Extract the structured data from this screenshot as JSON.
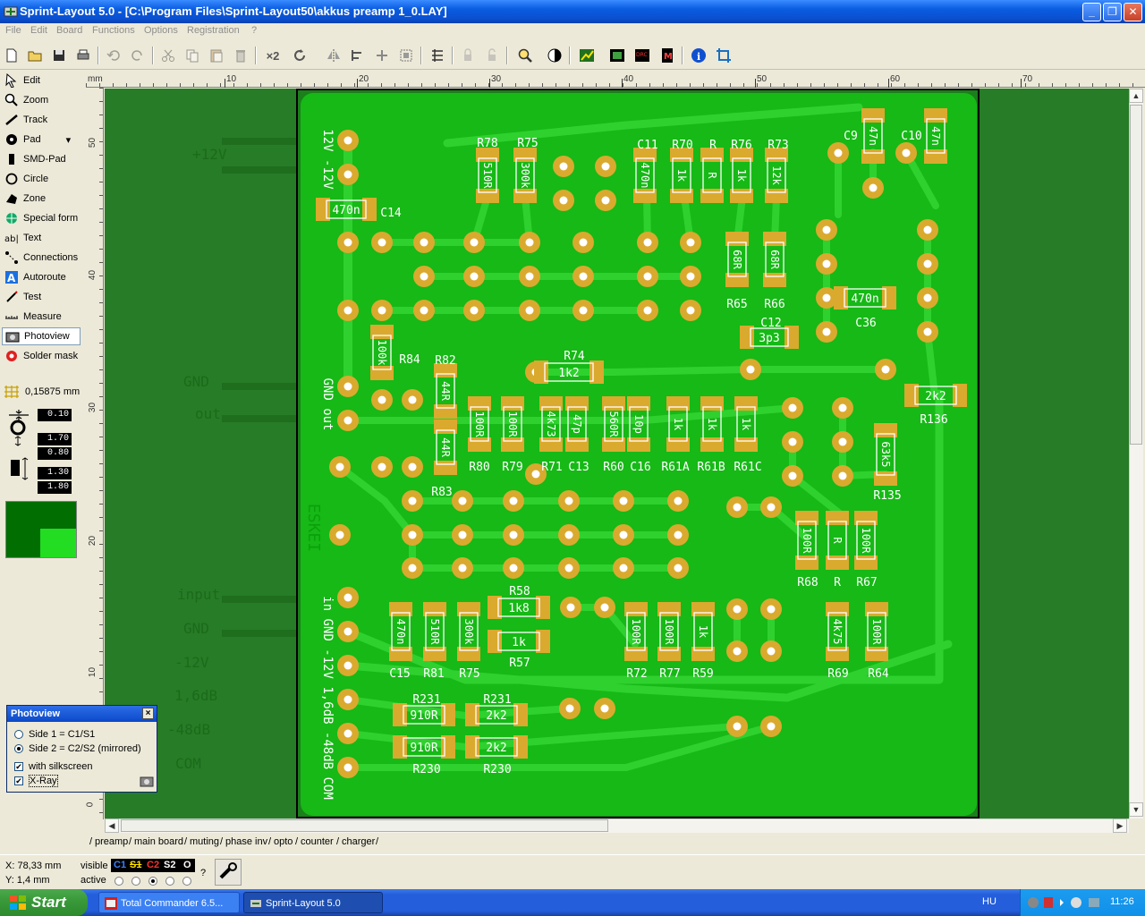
{
  "window": {
    "title": "Sprint-Layout 5.0 - [C:\\Program Files\\Sprint-Layout50\\akkus preamp 1_0.LAY]",
    "minimize": "_",
    "restore": "❐",
    "close": "✕"
  },
  "menu": [
    "File",
    "Edit",
    "Board",
    "Functions",
    "Options",
    "Registration",
    "?"
  ],
  "toolbar": {
    "x2_label": "×2"
  },
  "tools": [
    {
      "label": "Edit",
      "icon": "cursor-icon"
    },
    {
      "label": "Zoom",
      "icon": "zoom-icon"
    },
    {
      "label": "Track",
      "icon": "track-icon"
    },
    {
      "label": "Pad",
      "icon": "pad-icon"
    },
    {
      "label": "SMD-Pad",
      "icon": "smd-pad-icon"
    },
    {
      "label": "Circle",
      "icon": "circle-icon"
    },
    {
      "label": "Zone",
      "icon": "zone-icon"
    },
    {
      "label": "Special form",
      "icon": "special-form-icon"
    },
    {
      "label": "Text",
      "icon": "text-icon"
    },
    {
      "label": "Connections",
      "icon": "connections-icon"
    },
    {
      "label": "Autoroute",
      "icon": "autoroute-icon"
    },
    {
      "label": "Test",
      "icon": "test-icon"
    },
    {
      "label": "Measure",
      "icon": "measure-icon"
    },
    {
      "label": "Photoview",
      "icon": "camera-icon",
      "active": true
    },
    {
      "label": "Solder mask",
      "icon": "solder-mask-icon"
    }
  ],
  "grid_value": "0,15875 mm",
  "values": {
    "track_width": "0.10",
    "pad_outer": "1.70",
    "pad_inner": "0.80",
    "smd_w": "1.30",
    "smd_h": "1.80"
  },
  "ruler": {
    "unit": "mm",
    "top_labels": [
      "10",
      "20",
      "30",
      "40",
      "50",
      "60",
      "70"
    ],
    "left_labels": [
      "50",
      "40",
      "30",
      "20",
      "10",
      "0"
    ]
  },
  "tabs": [
    "preamp",
    "main board",
    "muting",
    "phase inv",
    "opto",
    "counter",
    "charger"
  ],
  "status": {
    "x": "X:   78,33 mm",
    "y": "Y:     1,4 mm",
    "visible_label": "visible",
    "active_label": "active",
    "layers": [
      "C1",
      "S1",
      "C2",
      "S2",
      "O"
    ],
    "question": "?"
  },
  "photoview": {
    "title": "Photoview",
    "side1": "Side 1 = C1/S1",
    "side2": "Side 2 = C2/S2 (mirrored)",
    "silkscreen": "with silkscreen",
    "xray": "X-Ray"
  },
  "taskbar": {
    "start": "Start",
    "items": [
      "Total Commander 6.5...",
      "Sprint-Layout 5.0"
    ],
    "lang": "HU",
    "time": "11:26"
  },
  "board": {
    "labels_left": [
      "12V -12V",
      "GND out",
      "ESKEI",
      "in GND -12V 1,6dB -48dB COM"
    ],
    "left_bg_texts": [
      "+12V",
      "GND",
      "out",
      "input",
      "GND",
      "-12V",
      "1,6dB",
      "-48dB",
      "COM"
    ],
    "components": [
      {
        "ref": "R78",
        "val": "510R"
      },
      {
        "ref": "R75",
        "val": "300k"
      },
      {
        "ref": "C11",
        "val": "470n"
      },
      {
        "ref": "R70",
        "val": "1k"
      },
      {
        "ref": "R",
        "val": "R"
      },
      {
        "ref": "R76",
        "val": "1k"
      },
      {
        "ref": "R73",
        "val": "12k"
      },
      {
        "ref": "C9",
        "val": "47n"
      },
      {
        "ref": "C10",
        "val": "47n"
      },
      {
        "ref": "C14",
        "val": "470n"
      },
      {
        "ref": "R65",
        "val": "68R"
      },
      {
        "ref": "R66",
        "val": "68R"
      },
      {
        "ref": "C36",
        "val": "470n"
      },
      {
        "ref": "C12",
        "val": "3p3"
      },
      {
        "ref": "R84",
        "val": "100k"
      },
      {
        "ref": "R82",
        "val": "44R"
      },
      {
        "ref": "R74",
        "val": "1k2"
      },
      {
        "ref": "R136",
        "val": "2k2"
      },
      {
        "ref": "R83",
        "val": "44R"
      },
      {
        "ref": "R80",
        "val": "100R"
      },
      {
        "ref": "R79",
        "val": "100R"
      },
      {
        "ref": "R71",
        "val": "4k73"
      },
      {
        "ref": "C13",
        "val": "47p"
      },
      {
        "ref": "R60",
        "val": "560R"
      },
      {
        "ref": "C16",
        "val": "10p"
      },
      {
        "ref": "R61A",
        "val": "1k"
      },
      {
        "ref": "R61B",
        "val": "1k"
      },
      {
        "ref": "R61C",
        "val": "1k"
      },
      {
        "ref": "R135",
        "val": "63k5"
      },
      {
        "ref": "R68",
        "val": "100R"
      },
      {
        "ref": "R",
        "val": "R"
      },
      {
        "ref": "R67",
        "val": "100R"
      },
      {
        "ref": "R58",
        "val": "1k8"
      },
      {
        "ref": "R57",
        "val": "1k"
      },
      {
        "ref": "C15",
        "val": "470n"
      },
      {
        "ref": "R81",
        "val": "510R"
      },
      {
        "ref": "R75",
        "val": "300k"
      },
      {
        "ref": "R72",
        "val": "100R"
      },
      {
        "ref": "R77",
        "val": "100R"
      },
      {
        "ref": "R59",
        "val": "1k"
      },
      {
        "ref": "R69",
        "val": "4k75"
      },
      {
        "ref": "R64",
        "val": "100R"
      },
      {
        "ref": "R231",
        "val": "910R"
      },
      {
        "ref": "R231",
        "val": "2k2"
      },
      {
        "ref": "R230",
        "val": "910R"
      },
      {
        "ref": "R230",
        "val": "2k2"
      }
    ]
  },
  "colors": {
    "canvas_bg": "#277c27",
    "board": "#16b916",
    "track": "#2fd12f",
    "pad": "#d9aa2e",
    "silk": "#ffffff"
  }
}
